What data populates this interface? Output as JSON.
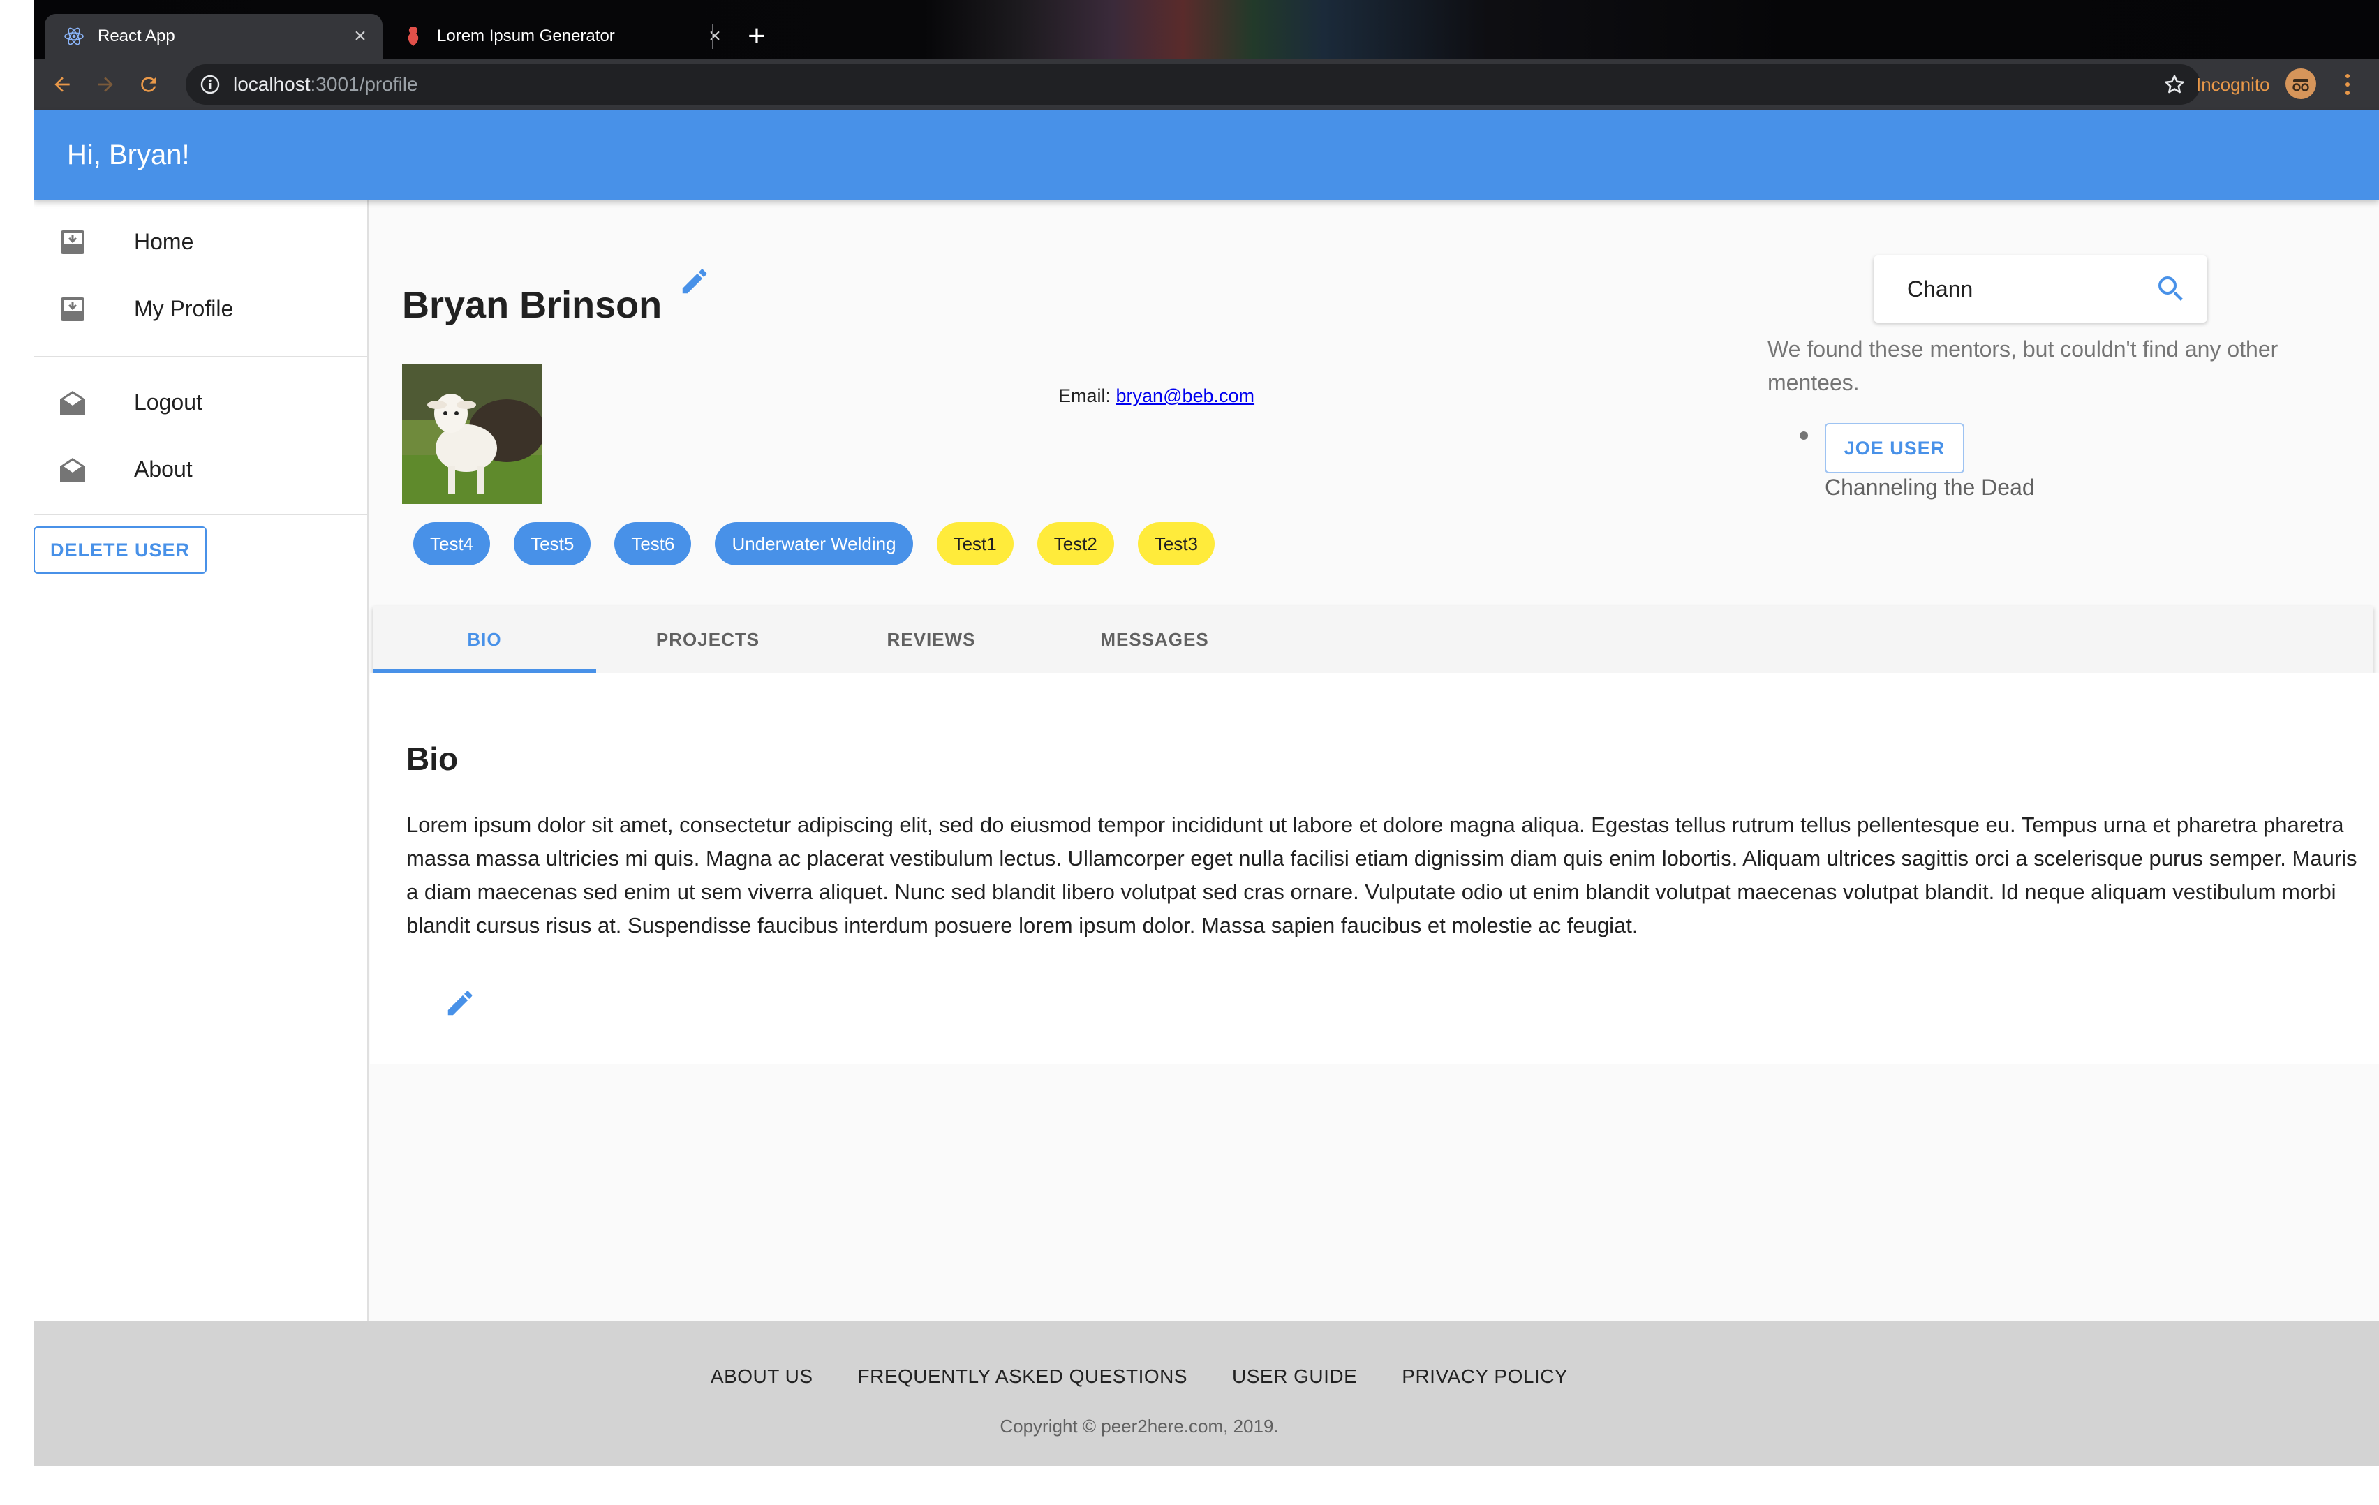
{
  "browser": {
    "tabs": [
      {
        "title": "React App",
        "icon": "react-logo-icon"
      },
      {
        "title": "Lorem Ipsum Generator",
        "icon": "lorem-favicon-icon"
      }
    ],
    "url_host": "localhost",
    "url_path": ":3001/profile",
    "incognito_label": "Incognito"
  },
  "appbar": {
    "greeting": "Hi, Bryan!",
    "color": "#4891e8"
  },
  "drawer": {
    "items": [
      {
        "label": "Home",
        "icon": "inbox-download-icon"
      },
      {
        "label": "My Profile",
        "icon": "inbox-download-icon"
      },
      {
        "label": "Logout",
        "icon": "mail-open-icon"
      },
      {
        "label": "About",
        "icon": "mail-open-icon"
      }
    ],
    "delete_label": "DELETE USER"
  },
  "profile": {
    "name": "Bryan Brinson",
    "email_label": "Email:",
    "email": "bryan@beb.com",
    "chips_blue": [
      "Test4",
      "Test5",
      "Test6",
      "Underwater Welding"
    ],
    "chips_yellow": [
      "Test1",
      "Test2",
      "Test3"
    ]
  },
  "search": {
    "value": "Chann",
    "result_text": "We found these mentors, but couldn't find any other mentees.",
    "mentor_button": "JOE USER",
    "mentor_subtitle": "Channeling the Dead"
  },
  "tabs": [
    "BIO",
    "PROJECTS",
    "REVIEWS",
    "MESSAGES"
  ],
  "bio": {
    "title": "Bio",
    "text": "Lorem ipsum dolor sit amet, consectetur adipiscing elit, sed do eiusmod tempor incididunt ut labore et dolore magna aliqua. Egestas tellus rutrum tellus pellentesque eu. Tempus urna et pharetra pharetra massa massa ultricies mi quis. Magna ac placerat vestibulum lectus. Ullamcorper eget nulla facilisi etiam dignissim diam quis enim lobortis. Aliquam ultrices sagittis orci a scelerisque purus semper. Mauris a diam maecenas sed enim ut sem viverra aliquet. Nunc sed blandit libero volutpat sed cras ornare. Vulputate odio ut enim blandit volutpat maecenas volutpat blandit. Id neque aliquam vestibulum morbi blandit cursus risus at. Suspendisse faucibus interdum posuere lorem ipsum dolor. Massa sapien faucibus et molestie ac feugiat."
  },
  "footer": {
    "links": [
      "ABOUT US",
      "FREQUENTLY ASKED QUESTIONS",
      "USER GUIDE",
      "PRIVACY POLICY"
    ],
    "copyright": "Copyright © peer2here.com, 2019."
  }
}
